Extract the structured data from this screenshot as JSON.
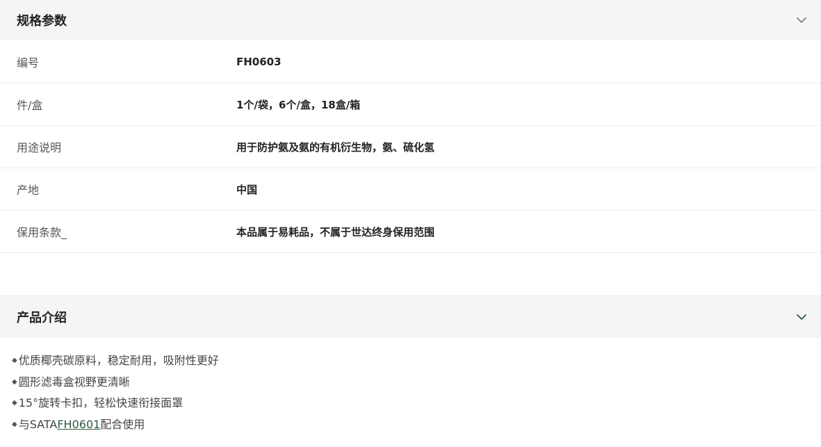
{
  "specs": {
    "title": "规格参数",
    "chevron_icon": "chevron-down-icon",
    "rows": [
      {
        "label": "编号",
        "value": "FH0603"
      },
      {
        "label": "件/盒",
        "value": "1个/袋，6个/盒，18盒/箱"
      },
      {
        "label": "用途说明",
        "value": "用于防护氨及氨的有机衍生物，氨、硫化氢"
      },
      {
        "label": "产地",
        "value": "中国"
      },
      {
        "label": "保用条款_",
        "value": "本品属于易耗品，不属于世达终身保用范围"
      }
    ]
  },
  "intro": {
    "title": "产品介绍",
    "chevron_icon": "chevron-down-icon",
    "accent_color": "#2d5a3d",
    "bullet": "◆",
    "items": [
      {
        "text": "优质椰壳碳原料，稳定耐用，吸附性更好"
      },
      {
        "text": "圆形滤毒盒视野更清晰"
      },
      {
        "text": "15°旋转卡扣，轻松快速衔接面罩"
      },
      {
        "prefix": "与SATA ",
        "link": "FH0601",
        "suffix": "配合使用"
      }
    ]
  }
}
